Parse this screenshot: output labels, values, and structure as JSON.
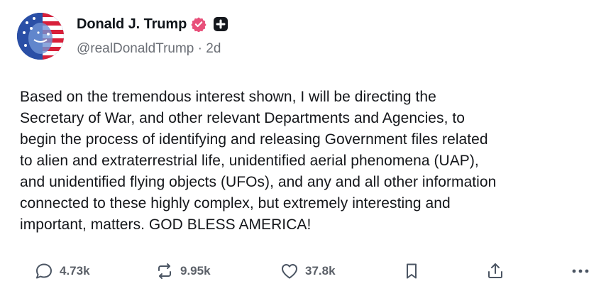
{
  "author": {
    "display_name": "Donald J. Trump",
    "handle": "@realDonaldTrump",
    "separator": "·",
    "time_ago": "2d"
  },
  "post": {
    "lines": [
      "Based on the tremendous interest shown, I will be directing the",
      "Secretary of War, and other relevant Departments and Agencies, to",
      "begin the process of identifying and releasing Government files related",
      "to alien and extraterrestrial life, unidentified aerial phenomena (UAP),",
      "and unidentified flying objects (UFOs), and any and all other information",
      "connected to these highly complex, but extremely interesting and",
      "important, matters. GOD BLESS AMERICA!"
    ]
  },
  "actions": {
    "replies": "4.73k",
    "reposts": "9.95k",
    "likes": "37.8k"
  },
  "icons": {
    "verified": "verified-badge-icon",
    "plus": "plus-badge-icon",
    "reply": "reply-icon",
    "repost": "repost-icon",
    "like": "heart-icon",
    "bookmark": "bookmark-icon",
    "share": "share-icon",
    "more": "more-icon"
  },
  "colors": {
    "verified": "#e8507a",
    "text": "#14161a",
    "muted": "#6b6f76",
    "icon": "#4b5563"
  }
}
